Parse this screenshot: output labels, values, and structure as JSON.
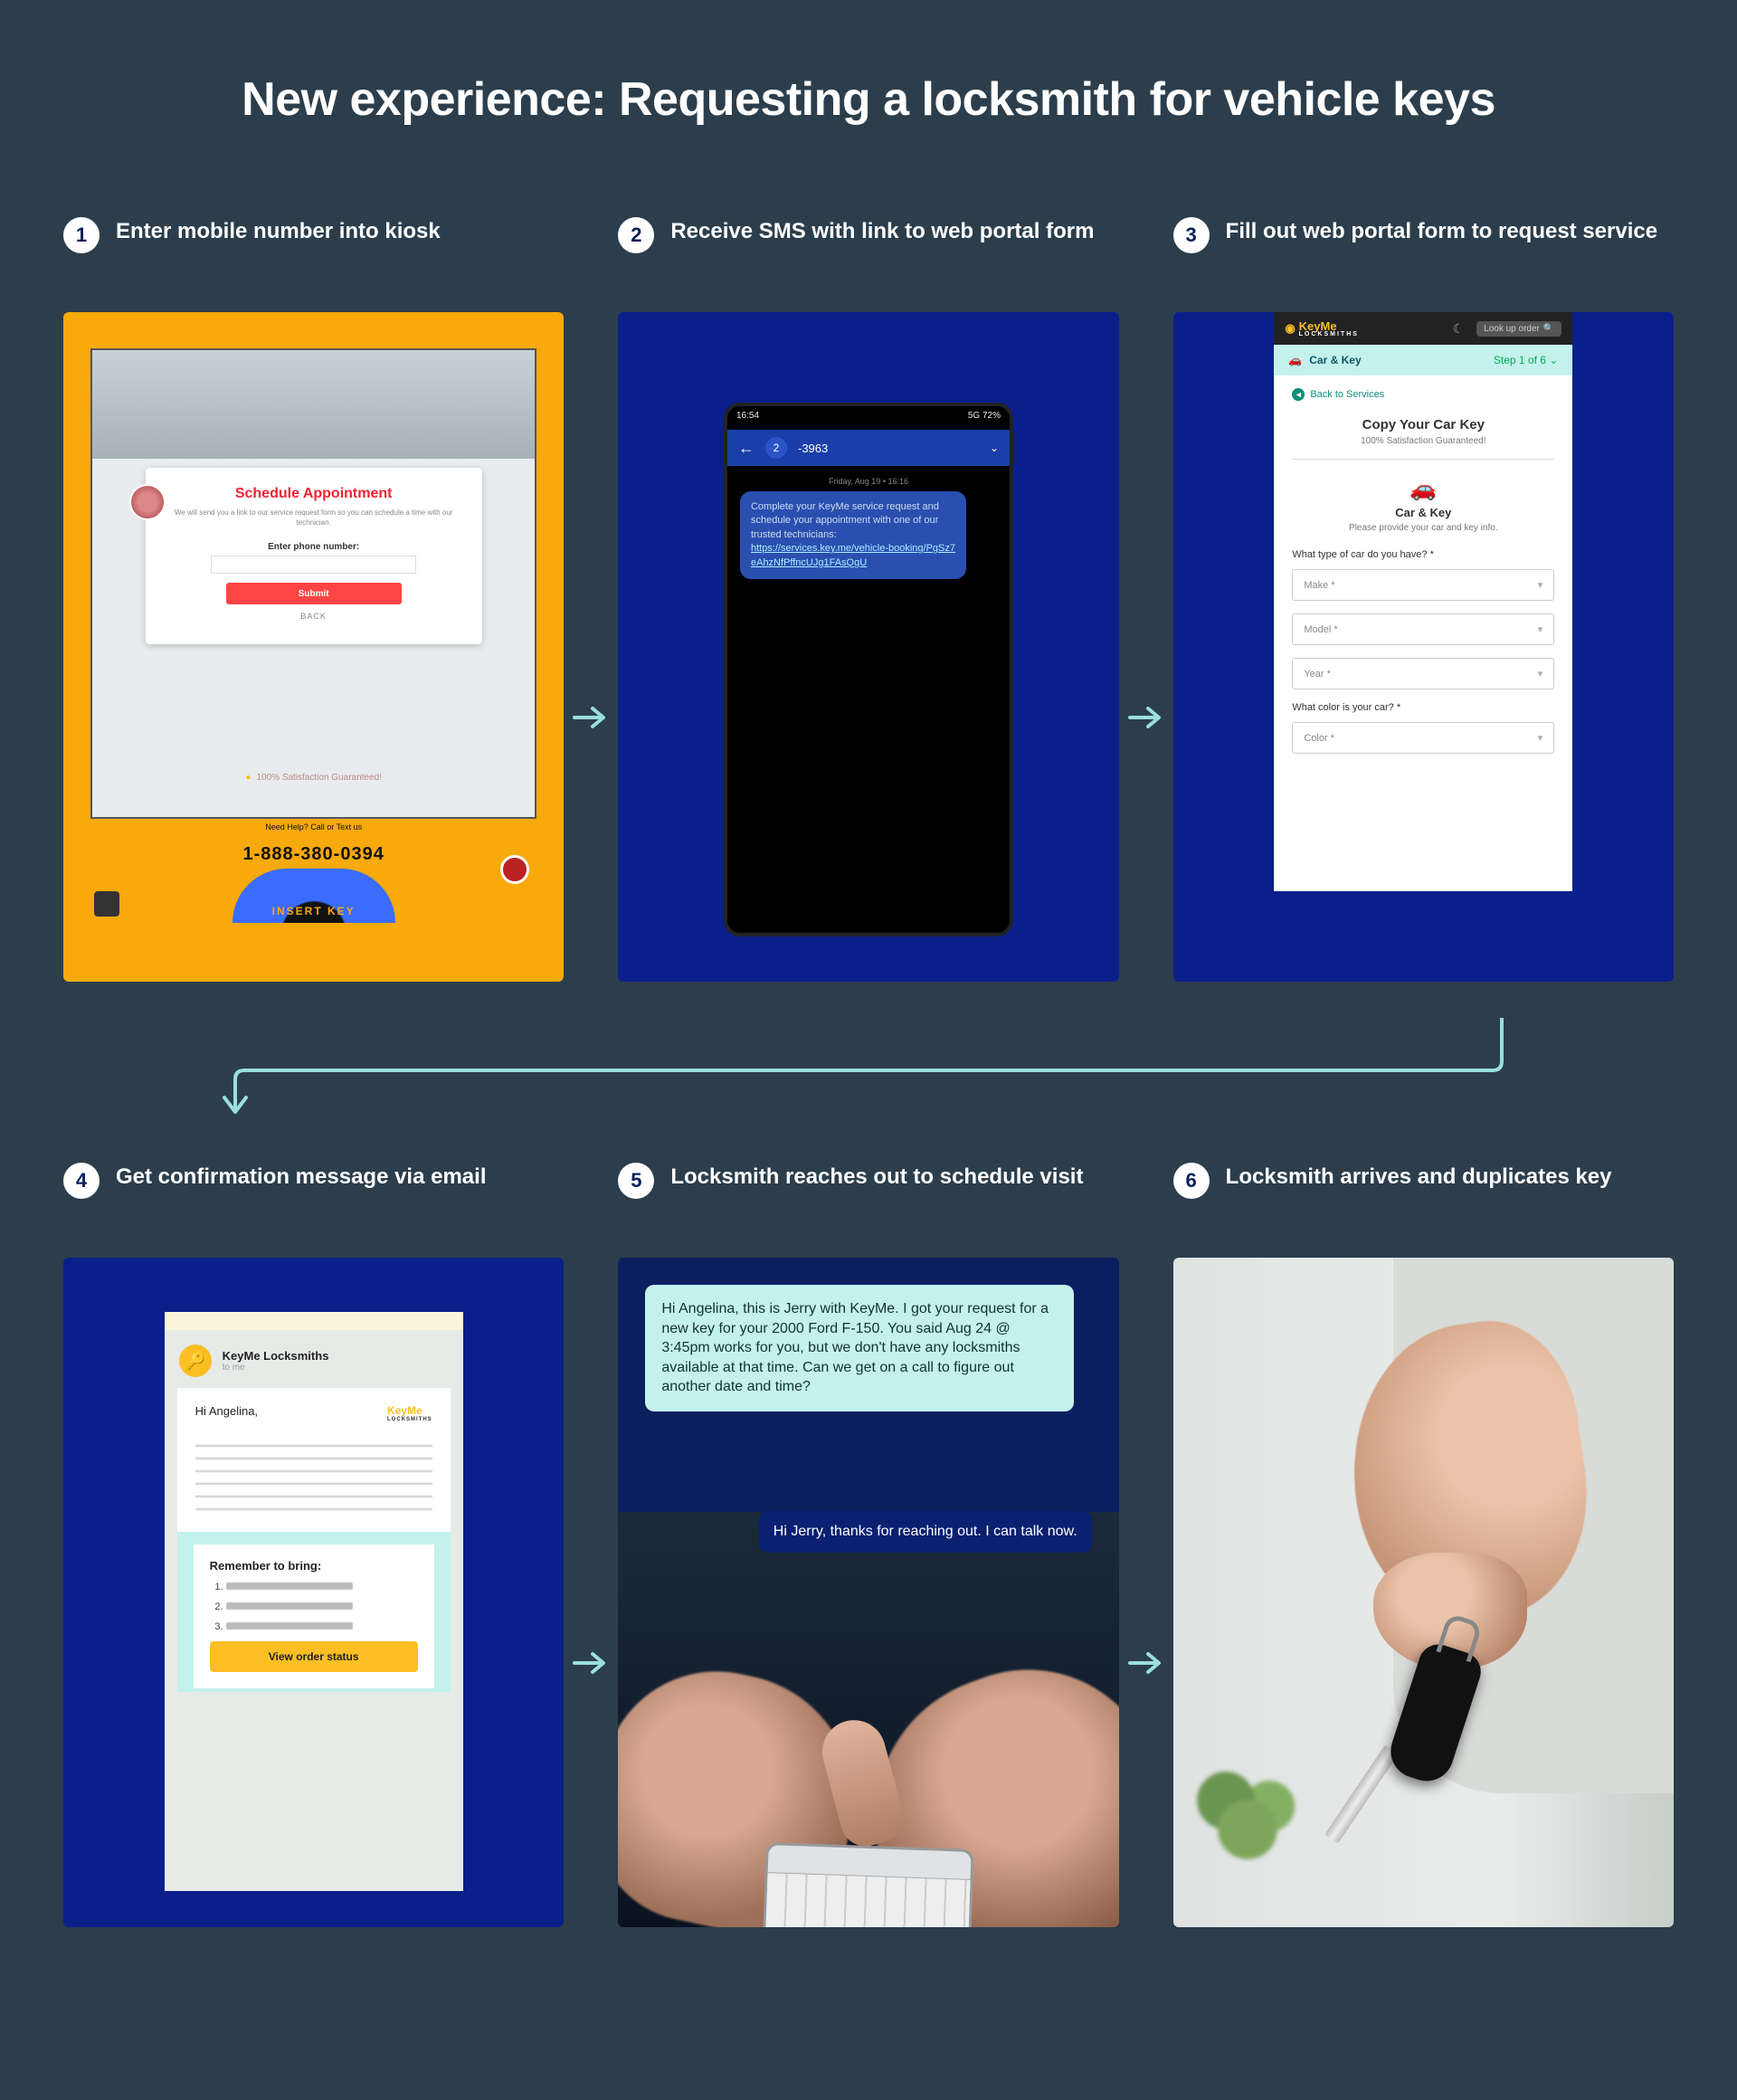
{
  "title": "New experience: Requesting a locksmith for vehicle keys",
  "steps": [
    {
      "num": "1",
      "label": "Enter mobile number into kiosk"
    },
    {
      "num": "2",
      "label": "Receive SMS with link to web portal form"
    },
    {
      "num": "3",
      "label": "Fill out web portal form to request service"
    },
    {
      "num": "4",
      "label": "Get confirmation message via email"
    },
    {
      "num": "5",
      "label": "Locksmith reaches out to schedule visit"
    },
    {
      "num": "6",
      "label": "Locksmith arrives and duplicates key"
    }
  ],
  "kiosk": {
    "card_title": "Schedule Appointment",
    "card_sub": "We will send you a link to our service request form so you can schedule a time with our technician.",
    "field_label": "Enter phone number:",
    "submit": "Submit",
    "back": "BACK",
    "guarantee": "100% Satisfaction Guaranteed!",
    "help_label": "Need Help? Call or Text us",
    "phone": "1-888-380-0394",
    "wheel": "INSERT KEY"
  },
  "sms": {
    "status_left": "16:54",
    "status_right": "5G 72%",
    "thread_badge": "2",
    "thread_number": "-3963",
    "date": "Friday, Aug 19 • 16:16",
    "msg_text": "Complete your KeyMe service request and schedule your appointment with one of our trusted technicians:",
    "msg_link": "https://services.key.me/vehicle-booking/PgSz7eAhzNfPffncUJg1FAsQgU"
  },
  "webform": {
    "brand": "KeyMe",
    "brand_sub": "LOCKSMITHS",
    "search_placeholder": "Look up order",
    "step_title": "Car & Key",
    "step_counter": "Step 1 of 6",
    "back_link": "Back to Services",
    "h1": "Copy Your Car Key",
    "h2": "100% Satisfaction Guaranteed!",
    "h3": "Car & Key",
    "h4": "Please provide your car and key info.",
    "q1": "What type of car do you have? *",
    "sel_make": "Make *",
    "sel_model": "Model *",
    "sel_year": "Year *",
    "q2": "What color is your car? *",
    "sel_color": "Color *"
  },
  "email": {
    "sender": "KeyMe Locksmiths",
    "to": "to me",
    "logo": "KeyMe",
    "logo_sub": "LOCKSMITHS",
    "greeting": "Hi Angelina,",
    "remember_title": "Remember to bring:",
    "items": [
      "1.",
      "2.",
      "3."
    ],
    "btn": "View order status"
  },
  "convo": {
    "incoming": "Hi Angelina, this is Jerry with KeyMe. I got your request for a new key for your 2000 Ford F-150. You said Aug 24 @ 3:45pm works for you, but we don't have any locksmiths available at that time. Can we get on a call to figure out another date and time?",
    "outgoing": "Hi Jerry, thanks for reaching out. I can talk now."
  }
}
